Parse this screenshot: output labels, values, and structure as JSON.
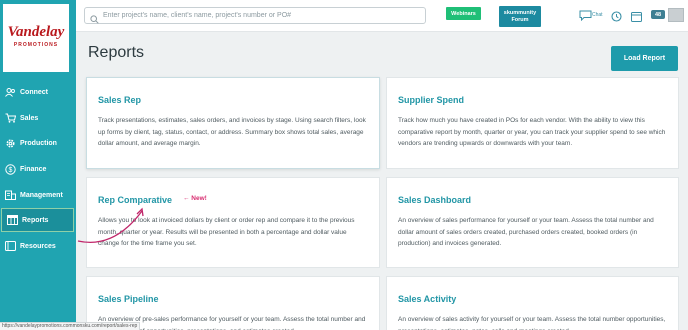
{
  "brand": {
    "logo_text": "Vandelay",
    "logo_sub": "PROMOTIONS",
    "accent": "#20a4b1"
  },
  "sidebar": {
    "items": [
      {
        "label": "Connect",
        "icon": "people-icon"
      },
      {
        "label": "Sales",
        "icon": "cart-icon"
      },
      {
        "label": "Production",
        "icon": "gear-icon"
      },
      {
        "label": "Finance",
        "icon": "dollar-icon"
      },
      {
        "label": "Management",
        "icon": "building-icon"
      },
      {
        "label": "Reports",
        "icon": "table-icon",
        "active": true
      },
      {
        "label": "Resources",
        "icon": "book-icon"
      }
    ]
  },
  "topbar": {
    "search_placeholder": "Enter project's name, client's name, project's number or PO#",
    "webinars_label": "Webinars",
    "forum_line1": "skummunity",
    "forum_line2": "Forum",
    "chat_label": "Chat",
    "badge_count": "48"
  },
  "main": {
    "title": "Reports",
    "load_button": "Load Report",
    "new_label": "← New!",
    "cards": [
      {
        "title": "Sales Rep",
        "desc": "Track presentations, estimates, sales orders, and invoices by stage. Using search filters, look up forms by client, tag, status, contact, or address. Summary box shows total sales, average dollar amount, and average margin."
      },
      {
        "title": "Supplier Spend",
        "desc": "Track how much you have created in POs for each vendor. With the ability to view this comparative report by month, quarter or year, you can track your supplier spend to see which vendors are trending upwards or downwards with your team."
      },
      {
        "title": "Rep Comparative",
        "desc": "Allows you to look at invoiced dollars by client or order rep and compare it to the previous month, quarter or year. Results will be presented in both a percentage and dollar value change for the time frame you set."
      },
      {
        "title": "Sales Dashboard",
        "desc": "An overview of sales performance for yourself or your team. Assess the total number and dollar amount of sales orders created, purchased orders created, booked orders (in production) and invoices generated."
      },
      {
        "title": "Sales Pipeline",
        "desc": "An overview of pre-sales performance for yourself or your team. Assess the total number and dollar amount of opportunities, presentations, and estimates created."
      },
      {
        "title": "Sales Activity",
        "desc": "An overview of sales activity for yourself or your team. Assess the total number opportunities, presentations, estimates, notes, calls and meetings created."
      }
    ]
  },
  "status_url": "https://vandelaypromotions.commonsku.com/report/sales-rep"
}
